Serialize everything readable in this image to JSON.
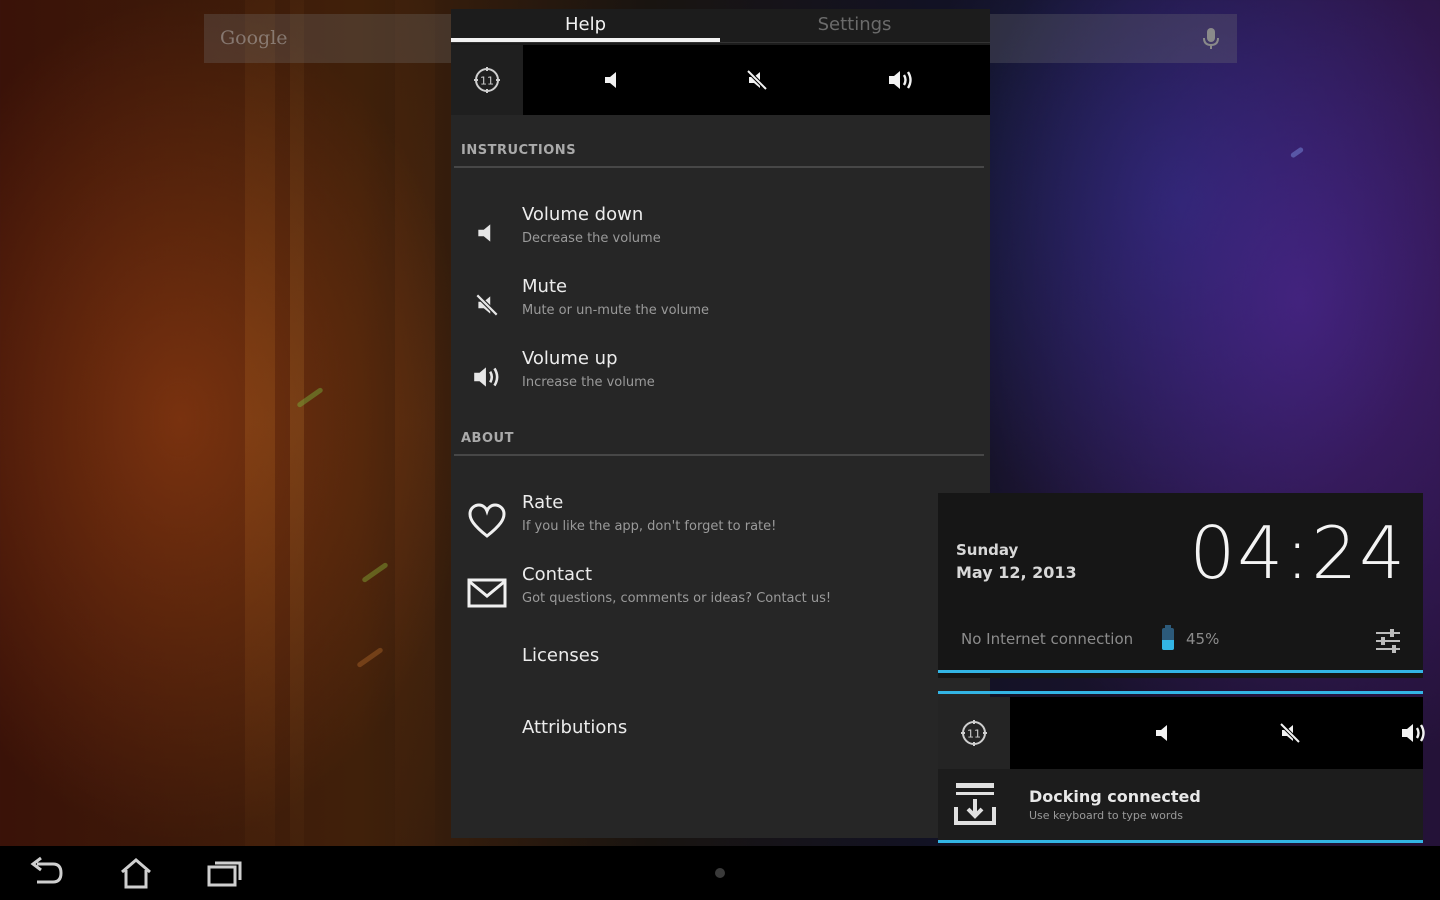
{
  "search": {
    "placeholder": "Google"
  },
  "tabs": [
    {
      "label": "Help",
      "active": true
    },
    {
      "label": "Settings",
      "active": false
    }
  ],
  "volume_bar": {
    "widget_label": "11",
    "buttons": [
      "volume-down-icon",
      "mute-icon",
      "volume-up-icon"
    ]
  },
  "sections": {
    "instructions": {
      "header": "INSTRUCTIONS",
      "items": [
        {
          "title": "Volume down",
          "subtitle": "Decrease the volume",
          "icon": "volume-down-icon"
        },
        {
          "title": "Mute",
          "subtitle": "Mute or un-mute the volume",
          "icon": "mute-icon"
        },
        {
          "title": "Volume up",
          "subtitle": "Increase the volume",
          "icon": "volume-up-icon"
        }
      ]
    },
    "about": {
      "header": "ABOUT",
      "items": [
        {
          "title": "Rate",
          "subtitle": "If you like the app, don't forget to rate!",
          "icon": "heart-icon"
        },
        {
          "title": "Contact",
          "subtitle": "Got questions, comments or ideas? Contact us!",
          "icon": "mail-icon"
        },
        {
          "title": "Licenses"
        },
        {
          "title": "Attributions"
        }
      ]
    }
  },
  "clock_widget": {
    "day": "Sunday",
    "date": "May 12, 2013",
    "time": "04:24",
    "network_status": "No Internet connection",
    "battery_percent": "45%",
    "battery_level": 0.45
  },
  "notification": {
    "widget_label": "11",
    "title": "Docking connected",
    "subtitle": "Use keyboard to type words"
  },
  "colors": {
    "accent": "#33b5e5",
    "panel": "#262626",
    "bar": "#000000"
  }
}
